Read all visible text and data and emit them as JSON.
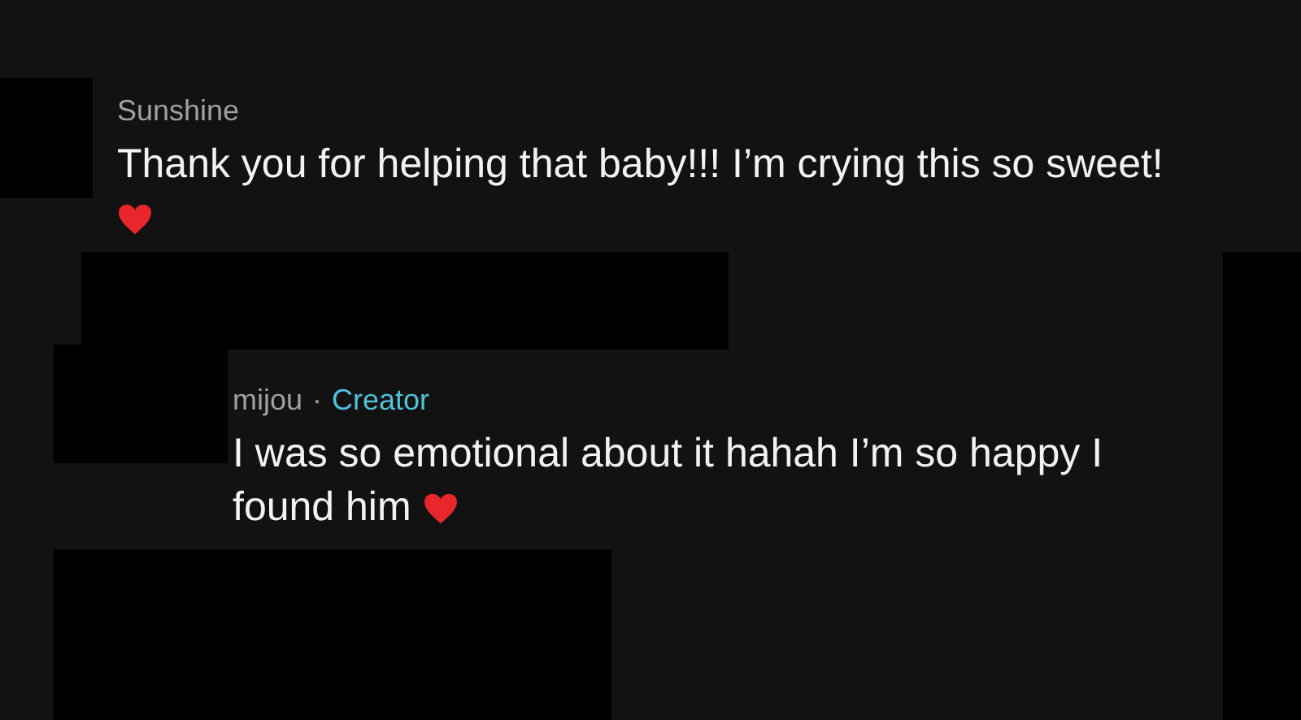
{
  "comments": [
    {
      "author": "Sunshine",
      "text": "Thank you for helping that baby!!! I’m crying this so sweet!",
      "reply": false
    },
    {
      "author": "mijou",
      "separator": "·",
      "badge": "Creator",
      "text": "I was so emotional about it hahah I’m so happy I found him",
      "reply": true
    }
  ]
}
